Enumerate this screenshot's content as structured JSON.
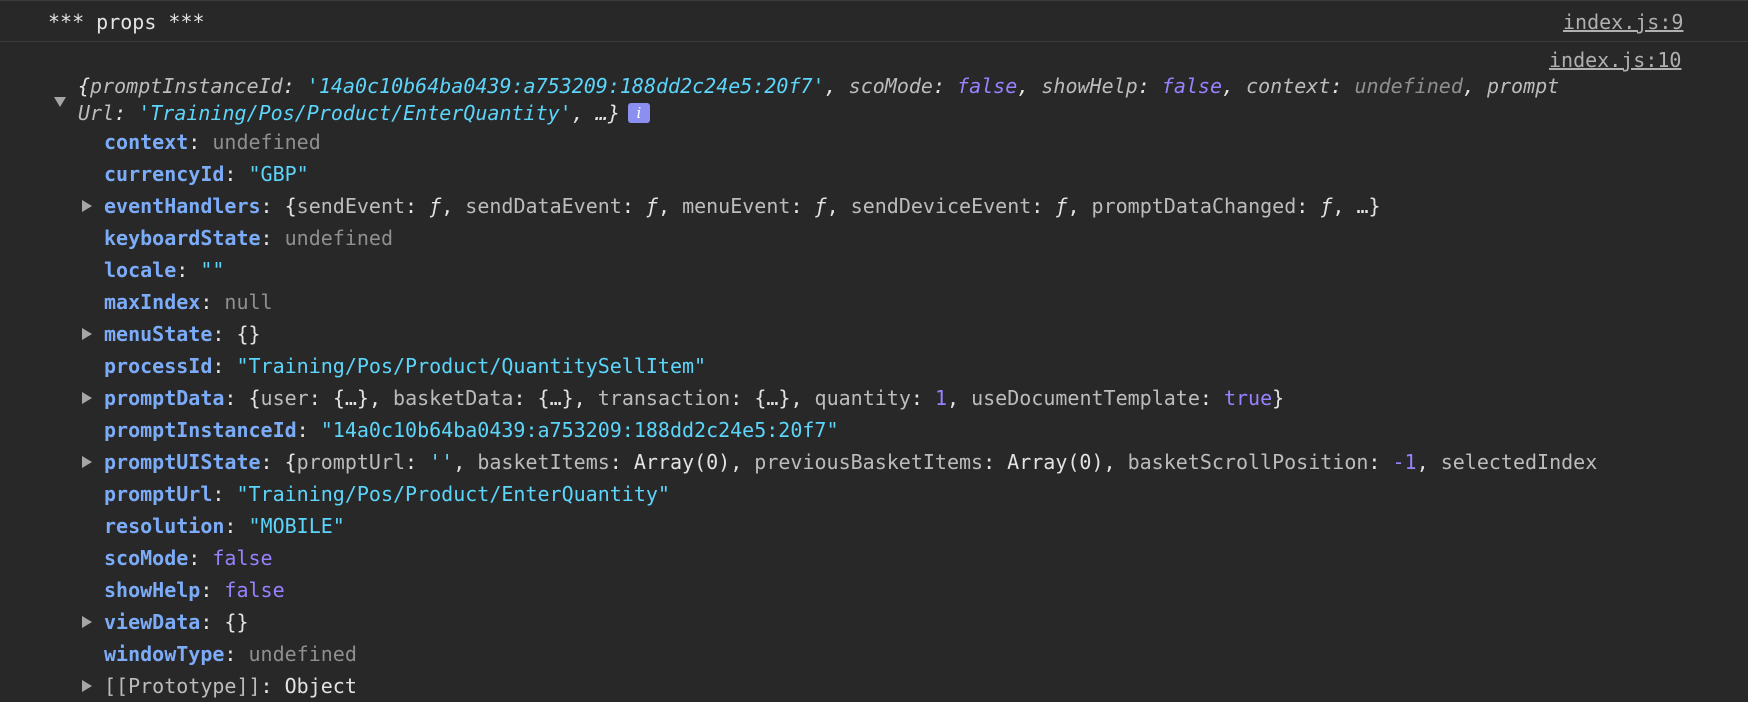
{
  "log1": {
    "text": "*** props ***",
    "source": "index.js:9"
  },
  "log2": {
    "source": "index.js:10",
    "summary": {
      "open": "{",
      "k1": "promptInstanceId",
      "v1": "'14a0c10b64ba0439:a753209:188dd2c24e5:20f7'",
      "k2": "scoMode",
      "v2": "false",
      "k3": "showHelp",
      "v3": "false",
      "k4": "context",
      "v4": "undefined",
      "k5a": "prompt",
      "k5b": "Url",
      "v5": "'Training/Pos/Product/EnterQuantity'",
      "tail": ", …}",
      "info": "i"
    }
  },
  "props": {
    "context": {
      "key": "context",
      "value": "undefined"
    },
    "currencyId": {
      "key": "currencyId",
      "value": "\"GBP\""
    },
    "eventHandlers": {
      "key": "eventHandlers",
      "items": [
        {
          "k": "sendEvent",
          "v": "ƒ"
        },
        {
          "k": "sendDataEvent",
          "v": "ƒ"
        },
        {
          "k": "menuEvent",
          "v": "ƒ"
        },
        {
          "k": "sendDeviceEvent",
          "v": "ƒ"
        },
        {
          "k": "promptDataChanged",
          "v": "ƒ"
        }
      ],
      "tail": "…}"
    },
    "keyboardState": {
      "key": "keyboardState",
      "value": "undefined"
    },
    "locale": {
      "key": "locale",
      "value": "\"\""
    },
    "maxIndex": {
      "key": "maxIndex",
      "value": "null"
    },
    "menuState": {
      "key": "menuState",
      "value": "{}"
    },
    "processId": {
      "key": "processId",
      "value": "\"Training/Pos/Product/QuantitySellItem\""
    },
    "promptData": {
      "key": "promptData",
      "user_k": "user",
      "user_v": "{…}",
      "basket_k": "basketData",
      "basket_v": "{…}",
      "tx_k": "transaction",
      "tx_v": "{…}",
      "qty_k": "quantity",
      "qty_v": "1",
      "udt_k": "useDocumentTemplate",
      "udt_v": "true"
    },
    "promptInstanceId": {
      "key": "promptInstanceId",
      "value": "\"14a0c10b64ba0439:a753209:188dd2c24e5:20f7\""
    },
    "promptUIState": {
      "key": "promptUIState",
      "url_k": "promptUrl",
      "url_v": "''",
      "bi_k": "basketItems",
      "bi_v": "Array(0)",
      "pbi_k": "previousBasketItems",
      "pbi_v": "Array(0)",
      "bsp_k": "basketScrollPosition",
      "bsp_v": "-1",
      "sel_k": "selectedIndex"
    },
    "promptUrl": {
      "key": "promptUrl",
      "value": "\"Training/Pos/Product/EnterQuantity\""
    },
    "resolution": {
      "key": "resolution",
      "value": "\"MOBILE\""
    },
    "scoMode": {
      "key": "scoMode",
      "value": "false"
    },
    "showHelp": {
      "key": "showHelp",
      "value": "false"
    },
    "viewData": {
      "key": "viewData",
      "value": "{}"
    },
    "windowType": {
      "key": "windowType",
      "value": "undefined"
    },
    "prototype": {
      "key": "[[Prototype]]",
      "value": "Object"
    }
  }
}
